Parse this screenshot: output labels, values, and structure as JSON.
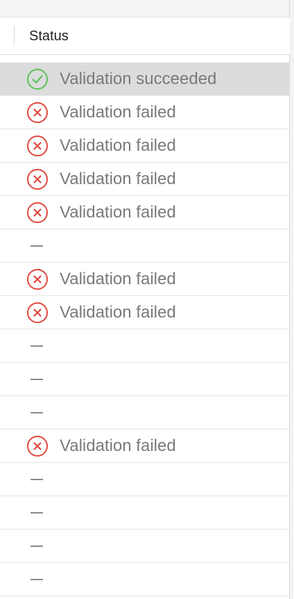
{
  "table": {
    "column_header": "Status",
    "rows": [
      {
        "status": "success",
        "text": "Validation succeeded",
        "selected": true
      },
      {
        "status": "failed",
        "text": "Validation failed"
      },
      {
        "status": "failed",
        "text": "Validation failed"
      },
      {
        "status": "failed",
        "text": "Validation failed"
      },
      {
        "status": "failed",
        "text": "Validation failed"
      },
      {
        "status": "none",
        "text": "–"
      },
      {
        "status": "failed",
        "text": "Validation failed"
      },
      {
        "status": "failed",
        "text": "Validation failed"
      },
      {
        "status": "none",
        "text": "–"
      },
      {
        "status": "none",
        "text": "–"
      },
      {
        "status": "none",
        "text": "–"
      },
      {
        "status": "failed",
        "text": "Validation failed"
      },
      {
        "status": "none",
        "text": "–"
      },
      {
        "status": "none",
        "text": "–"
      },
      {
        "status": "none",
        "text": "–"
      },
      {
        "status": "none",
        "text": "–"
      }
    ]
  },
  "colors": {
    "success": "#5cc15a",
    "failed": "#e0483d",
    "text": "#7a7a7a",
    "selected_row": "#dcdcdc"
  },
  "icons": {
    "success": "checkmark-circle-icon",
    "failed": "x-circle-icon",
    "none": "dash-icon"
  }
}
